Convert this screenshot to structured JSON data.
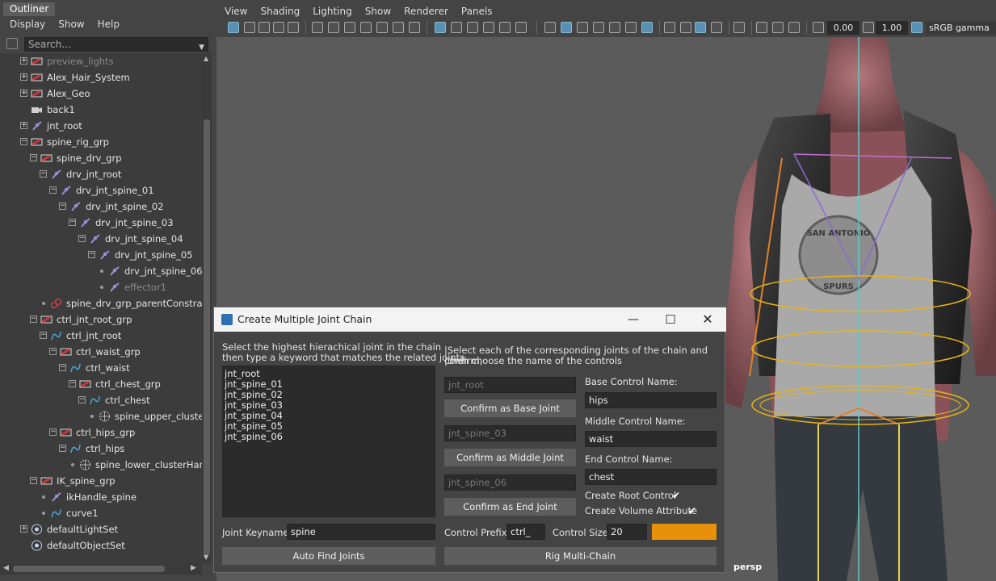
{
  "outliner": {
    "tab": "Outliner",
    "menu": [
      "Display",
      "Show",
      "Help"
    ],
    "search_placeholder": "Search...",
    "nodes": [
      {
        "label": "preview_lights",
        "depth": 0,
        "icon": "group",
        "expander": "plus",
        "dim": true
      },
      {
        "label": "Alex_Hair_System",
        "depth": 0,
        "icon": "group",
        "expander": "plus"
      },
      {
        "label": "Alex_Geo",
        "depth": 0,
        "icon": "group",
        "expander": "plus"
      },
      {
        "label": "back1",
        "depth": 0,
        "icon": "camera",
        "expander": "none"
      },
      {
        "label": "jnt_root",
        "depth": 0,
        "icon": "joint",
        "expander": "plus"
      },
      {
        "label": "spine_rig_grp",
        "depth": 0,
        "icon": "group",
        "expander": "minus"
      },
      {
        "label": "spine_drv_grp",
        "depth": 1,
        "icon": "group",
        "expander": "minus"
      },
      {
        "label": "drv_jnt_root",
        "depth": 2,
        "icon": "joint",
        "expander": "minus"
      },
      {
        "label": "drv_jnt_spine_01",
        "depth": 3,
        "icon": "joint",
        "expander": "minus"
      },
      {
        "label": "drv_jnt_spine_02",
        "depth": 4,
        "icon": "joint",
        "expander": "minus"
      },
      {
        "label": "drv_jnt_spine_03",
        "depth": 5,
        "icon": "joint",
        "expander": "minus"
      },
      {
        "label": "drv_jnt_spine_04",
        "depth": 6,
        "icon": "joint",
        "expander": "minus"
      },
      {
        "label": "drv_jnt_spine_05",
        "depth": 7,
        "icon": "joint",
        "expander": "minus"
      },
      {
        "label": "drv_jnt_spine_06",
        "depth": 8,
        "icon": "joint",
        "expander": "dot"
      },
      {
        "label": "effector1",
        "depth": 8,
        "icon": "effector",
        "expander": "dot",
        "dim": true
      },
      {
        "label": "spine_drv_grp_parentConstraint",
        "depth": 2,
        "icon": "constraint",
        "expander": "dot"
      },
      {
        "label": "ctrl_jnt_root_grp",
        "depth": 1,
        "icon": "group",
        "expander": "minus"
      },
      {
        "label": "ctrl_jnt_root",
        "depth": 2,
        "icon": "curve",
        "expander": "minus"
      },
      {
        "label": "ctrl_waist_grp",
        "depth": 3,
        "icon": "group",
        "expander": "minus"
      },
      {
        "label": "ctrl_waist",
        "depth": 4,
        "icon": "curve",
        "expander": "minus"
      },
      {
        "label": "ctrl_chest_grp",
        "depth": 5,
        "icon": "group",
        "expander": "minus"
      },
      {
        "label": "ctrl_chest",
        "depth": 6,
        "icon": "curve",
        "expander": "minus"
      },
      {
        "label": "spine_upper_clusterHandle",
        "depth": 7,
        "icon": "cluster",
        "expander": "dot"
      },
      {
        "label": "ctrl_hips_grp",
        "depth": 3,
        "icon": "group",
        "expander": "minus"
      },
      {
        "label": "ctrl_hips",
        "depth": 4,
        "icon": "curve",
        "expander": "minus"
      },
      {
        "label": "spine_lower_clusterHandle",
        "depth": 5,
        "icon": "cluster",
        "expander": "dot"
      },
      {
        "label": "IK_spine_grp",
        "depth": 1,
        "icon": "group",
        "expander": "minus"
      },
      {
        "label": "ikHandle_spine",
        "depth": 2,
        "icon": "ikhandle",
        "expander": "dot"
      },
      {
        "label": "curve1",
        "depth": 2,
        "icon": "curve",
        "expander": "dot"
      },
      {
        "label": "defaultLightSet",
        "depth": 0,
        "icon": "set",
        "expander": "plus"
      },
      {
        "label": "defaultObjectSet",
        "depth": 0,
        "icon": "set",
        "expander": "none"
      }
    ]
  },
  "viewport": {
    "menu": [
      "View",
      "Shading",
      "Lighting",
      "Show",
      "Renderer",
      "Panels"
    ],
    "exposure": "0.00",
    "gamma": "1.00",
    "color_space": "sRGB gamma (le",
    "camera_label": "persp",
    "shirt_text_top": "SAN ANTONIO",
    "shirt_text_bottom": "SPURS"
  },
  "dialog": {
    "title": "Create Multiple Joint Chain",
    "left_instructions": [
      "Select the highest hierachical joint in the chain",
      "then type a keyword that matches the related joints"
    ],
    "right_instructions": [
      "|Select each of the corresponding joints of the chain and confirm,",
      "|then choose the name of the controls"
    ],
    "joint_list": [
      "jnt_root",
      "jnt_spine_01",
      "jnt_spine_02",
      "jnt_spine_03",
      "jnt_spine_04",
      "jnt_spine_05",
      "jnt_spine_06"
    ],
    "base_joint_value": "jnt_root",
    "confirm_base_label": "Confirm as Base Joint",
    "middle_joint_value": "jnt_spine_03",
    "confirm_middle_label": "Confirm as Middle Joint",
    "end_joint_value": "jnt_spine_06",
    "confirm_end_label": "Confirm as End Joint",
    "base_control_label": "Base Control Name:",
    "base_control_value": "hips",
    "middle_control_label": "Middle Control Name:",
    "middle_control_value": "waist",
    "end_control_label": "End Control Name:",
    "end_control_value": "chest",
    "create_root_label": "Create Root Control",
    "create_root_checked": true,
    "create_volume_label": "Create Volume Attribute",
    "create_volume_checked": true,
    "keyname_label": "Joint Keyname:",
    "keyname_value": "spine",
    "prefix_label": "Control Prefix:",
    "prefix_value": "ctrl_",
    "size_label": "Control Size",
    "size_value": "20",
    "control_color": "#e8900a",
    "auto_find_label": "Auto Find Joints",
    "rig_label": "Rig Multi-Chain",
    "check_glyph": "✔"
  }
}
